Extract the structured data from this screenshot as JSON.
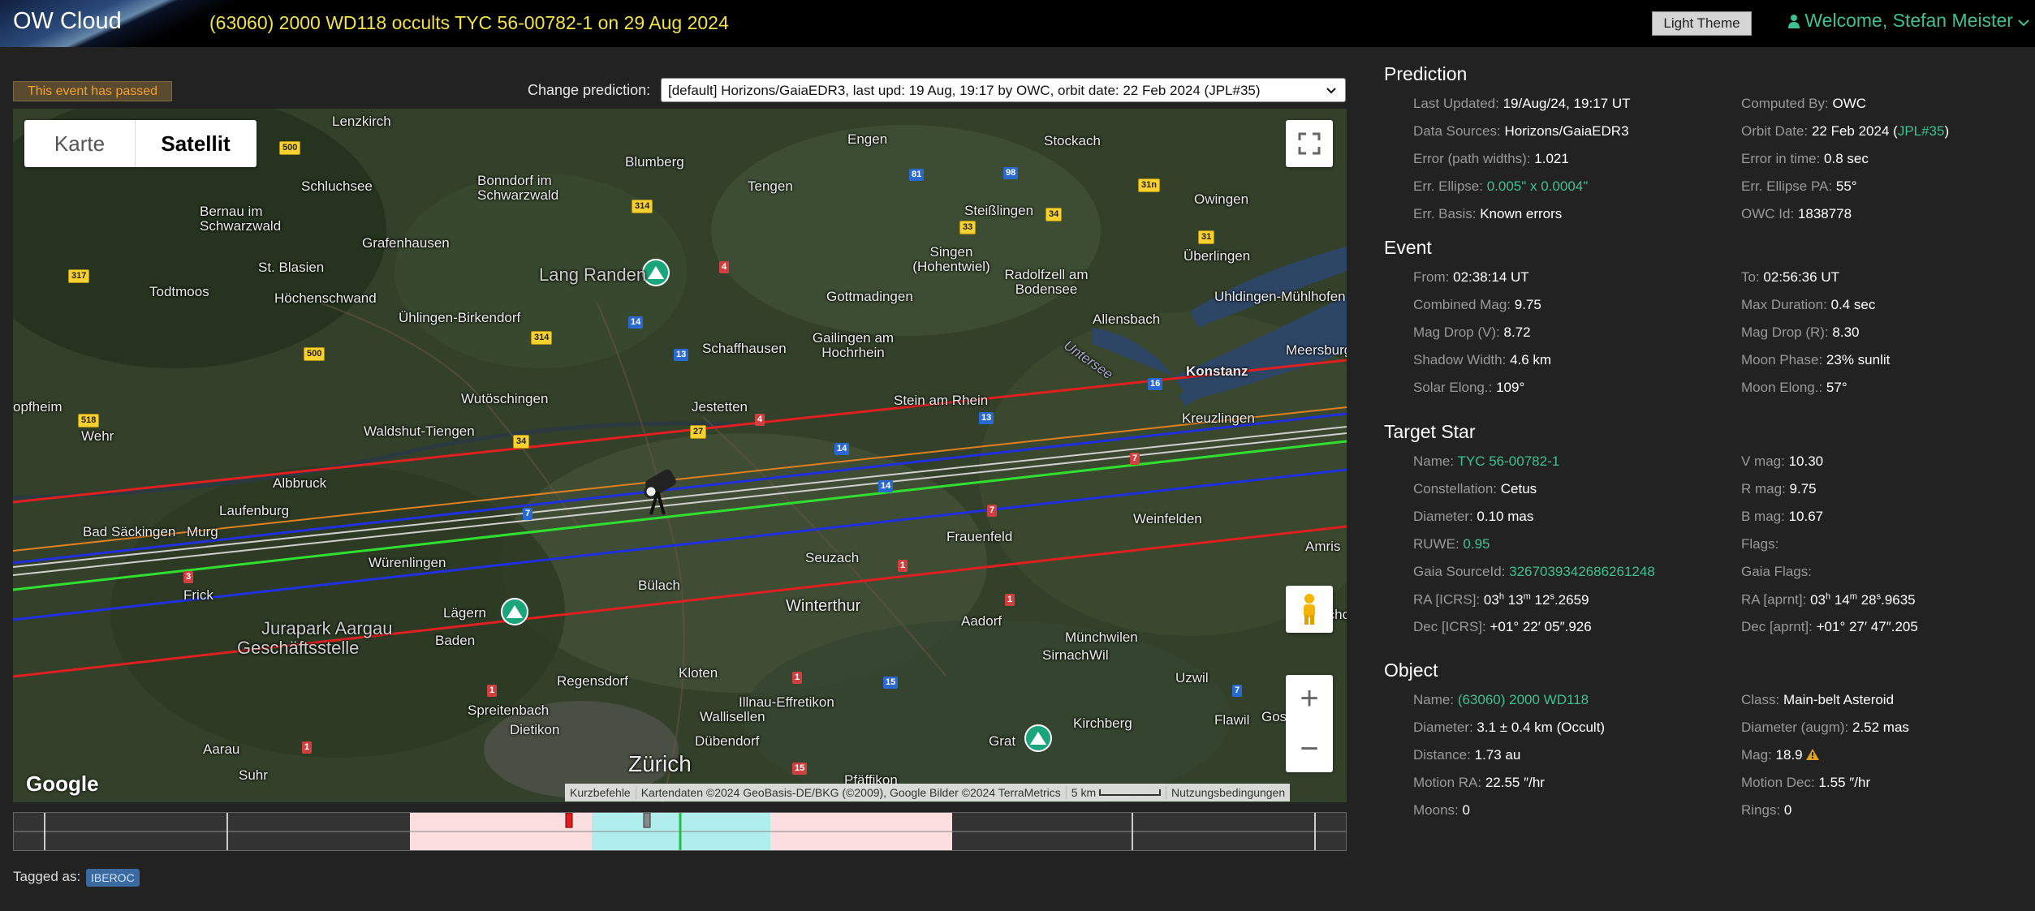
{
  "header": {
    "logo": "OW Cloud",
    "title": "(63060) 2000 WD118 occults TYC 56-00782-1 on 29 Aug 2024",
    "theme_button": "Light Theme",
    "welcome": "Welcome, Stefan Meister"
  },
  "colors": {
    "accent_green": "#3ec190",
    "title_yellow": "#f2e24a",
    "passed_orange": "#f0a030",
    "path_red": "#e02020",
    "path_orange": "#e08020",
    "path_blue": "#2030e0",
    "path_green": "#30e030",
    "path_white": "#d0d0d0"
  },
  "status_badge": "This event has passed",
  "prediction_selector": {
    "label": "Change prediction:",
    "selected": "[default] Horizons/GaiaEDR3, last upd: 19 Aug, 19:17 by OWC, orbit date: 22 Feb 2024 (JPL#35)"
  },
  "map": {
    "type_buttons": [
      "Karte",
      "Satellit"
    ],
    "active_type": "Satellit",
    "places": [
      "Lenzkirch",
      "Schluchsee",
      "Bonndorf im Schwarzwald",
      "Bernau im Schwarzwald",
      "Grafenhausen",
      "St. Blasien",
      "Todtmoos",
      "Höchenschwand",
      "Ühlingen-Birkendorf",
      "Blumberg",
      "Tengen",
      "Engen",
      "Stockach",
      "Owingen",
      "Steißlingen",
      "Singen (Hohentwiel)",
      "Radolfzell am Bodensee",
      "Überlingen",
      "Uhldingen-Mühlhofen",
      "Lang Randen",
      "Gottmadingen",
      "Allensbach",
      "Schaffhausen",
      "Gailingen am Hochrhein",
      "Meersburg",
      "Konstanz",
      "Untersee",
      "Kreuzlingen",
      "Wutöschingen",
      "Jestetten",
      "Stein am Rhein",
      "opfheim",
      "Wehr",
      "Waldshut-Tiengen",
      "Albbruck",
      "Laufenburg",
      "Bad Säckingen",
      "Murg",
      "Weinfelden",
      "Frauenfeld",
      "Amris",
      "Seuzach",
      "Würenlingen",
      "Frick",
      "Bülach",
      "Winterthur",
      "Lägern",
      "Aadorf",
      "Bischo",
      "Jurapark Aargau",
      "Geschäftsstelle",
      "Baden",
      "Münchwilen",
      "Sirnach",
      "Wil",
      "Uzwil",
      "Regensdorf",
      "Kloten",
      "Illnau-Effretikon",
      "Flawil",
      "Gos",
      "Spreitenbach",
      "Dietikon",
      "Wallisellen",
      "Dübendorf",
      "Kirchberg",
      "Aarau",
      "Zürich",
      "Grat",
      "Pfäffikon",
      "Suhr"
    ],
    "road_numbers": [
      "500",
      "314",
      "81",
      "98",
      "31n",
      "34",
      "33",
      "31",
      "317",
      "4",
      "14",
      "13",
      "500",
      "314",
      "518",
      "34",
      "27",
      "4",
      "14",
      "13",
      "16",
      "7",
      "14",
      "7",
      "3",
      "7",
      "1",
      "1",
      "1",
      "1",
      "15",
      "7",
      "1",
      "15"
    ],
    "google_logo": "Google",
    "attribution": [
      "Kurzbefehle",
      "Kartendaten ©2024 GeoBasis-DE/BKG (©2009), Google Bilder ©2024 TerraMetrics",
      "5 km",
      "Nutzungsbedingungen"
    ]
  },
  "tags": {
    "label": "Tagged as:",
    "items": [
      "IBEROC"
    ]
  },
  "prediction": {
    "title": "Prediction",
    "left": [
      {
        "label": "Last Updated:",
        "value": "19/Aug/24, 19:17 UT"
      },
      {
        "label": "Data Sources:",
        "value": "Horizons/GaiaEDR3"
      },
      {
        "label": "Error (path widths):",
        "value": "1.021"
      },
      {
        "label": "Err. Ellipse:",
        "value": "0.005\" x 0.0004\""
      },
      {
        "label": "Err. Basis:",
        "value": "Known errors"
      }
    ],
    "right": [
      {
        "label": "Computed By:",
        "value": "OWC"
      },
      {
        "label": "Orbit Date:",
        "value": "22 Feb 2024",
        "extra": "JPL#35"
      },
      {
        "label": "Error in time:",
        "value": "0.8 sec"
      },
      {
        "label": "Err. Ellipse PA:",
        "value": "55°"
      },
      {
        "label": "OWC Id:",
        "value": "1838778"
      }
    ]
  },
  "event": {
    "title": "Event",
    "left": [
      {
        "label": "From:",
        "value": "02:38:14 UT"
      },
      {
        "label": "Combined Mag:",
        "value": "9.75"
      },
      {
        "label": "Mag Drop (V):",
        "value": "8.72"
      },
      {
        "label": "Shadow Width:",
        "value": "4.6 km"
      },
      {
        "label": "Solar Elong.:",
        "value": "109°"
      }
    ],
    "right": [
      {
        "label": "To:",
        "value": "02:56:36 UT"
      },
      {
        "label": "Max Duration:",
        "value": "0.4 sec"
      },
      {
        "label": "Mag Drop (R):",
        "value": "8.30"
      },
      {
        "label": "Moon Phase:",
        "value": "23% sunlit"
      },
      {
        "label": "Moon Elong.:",
        "value": "57°"
      }
    ]
  },
  "target_star": {
    "title": "Target Star",
    "left": [
      {
        "label": "Name:",
        "value": "TYC 56-00782-1"
      },
      {
        "label": "Constellation:",
        "value": "Cetus"
      },
      {
        "label": "Diameter:",
        "value": "0.10 mas"
      },
      {
        "label": "RUWE:",
        "value": "0.95"
      },
      {
        "label": "Gaia SourceId:",
        "value": "3267039342686261248"
      },
      {
        "label": "RA [ICRS]:",
        "h": "03",
        "m": "13",
        "s": "12",
        "frac": ".2659"
      },
      {
        "label": "Dec [ICRS]:",
        "value": "+01° 22′ 05″.926"
      }
    ],
    "right": [
      {
        "label": "V mag:",
        "value": "10.30"
      },
      {
        "label": "R mag:",
        "value": "9.75"
      },
      {
        "label": "B mag:",
        "value": "10.67"
      },
      {
        "label": "Flags:",
        "value": ""
      },
      {
        "label": "Gaia Flags:",
        "value": ""
      },
      {
        "label": "RA [aprnt]:",
        "h": "03",
        "m": "14",
        "s": "28",
        "frac": ".9635"
      },
      {
        "label": "Dec [aprnt]:",
        "value": "+01° 27′ 47″.205"
      }
    ]
  },
  "object": {
    "title": "Object",
    "left": [
      {
        "label": "Name:",
        "value": "(63060) 2000 WD118"
      },
      {
        "label": "Diameter:",
        "value": "3.1 ± 0.4 km",
        "extra": "(Occult)"
      },
      {
        "label": "Distance:",
        "value": "1.73 au"
      },
      {
        "label": "Motion RA:",
        "value": "22.55 ″/hr"
      },
      {
        "label": "Moons:",
        "value": "0"
      }
    ],
    "right": [
      {
        "label": "Class:",
        "value": "Main-belt Asteroid"
      },
      {
        "label": "Diameter (augm):",
        "value": "2.52 mas"
      },
      {
        "label": "Mag:",
        "value": "18.9"
      },
      {
        "label": "Motion Dec:",
        "value": "1.55 ″/hr"
      },
      {
        "label": "Rings:",
        "value": "0"
      }
    ]
  }
}
